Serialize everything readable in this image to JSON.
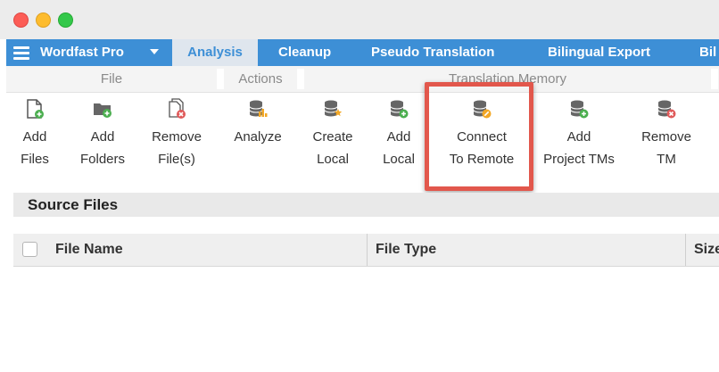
{
  "window": {
    "traffic_lights": [
      "close",
      "minimize",
      "zoom"
    ]
  },
  "ribbon": {
    "menu_label": "Wordfast Pro",
    "tabs": [
      {
        "label": "Analysis",
        "active": true
      },
      {
        "label": "Cleanup"
      },
      {
        "label": "Pseudo Translation"
      },
      {
        "label": "Bilingual Export"
      },
      {
        "label": "Bil"
      }
    ],
    "groups": [
      {
        "label": "File"
      },
      {
        "label": "Actions"
      },
      {
        "label": "Translation Memory"
      }
    ]
  },
  "toolbar": {
    "buttons": [
      {
        "line1": "Add",
        "line2": "Files",
        "icon": "add-file-icon"
      },
      {
        "line1": "Add",
        "line2": "Folders",
        "icon": "add-folder-icon"
      },
      {
        "line1": "Remove",
        "line2": "File(s)",
        "icon": "remove-file-icon"
      },
      {
        "line1": "Analyze",
        "line2": "",
        "icon": "analyze-icon"
      },
      {
        "line1": "Create",
        "line2": "Local",
        "icon": "create-local-tm-icon"
      },
      {
        "line1": "Add",
        "line2": "Local",
        "icon": "add-local-tm-icon"
      },
      {
        "line1": "Connect",
        "line2": "To Remote",
        "icon": "connect-remote-tm-icon",
        "highlighted": true
      },
      {
        "line1": "Add",
        "line2": "Project TMs",
        "icon": "add-project-tm-icon"
      },
      {
        "line1": "Remove",
        "line2": "TM",
        "icon": "remove-tm-icon"
      }
    ]
  },
  "source_files": {
    "title": "Source Files",
    "columns": [
      "File Name",
      "File Type",
      "Size"
    ],
    "rows": []
  },
  "colors": {
    "ribbon_blue": "#3d8fd6",
    "highlight_red": "#e2574c",
    "green_badge": "#4caf50",
    "red_badge": "#e05a5a"
  }
}
